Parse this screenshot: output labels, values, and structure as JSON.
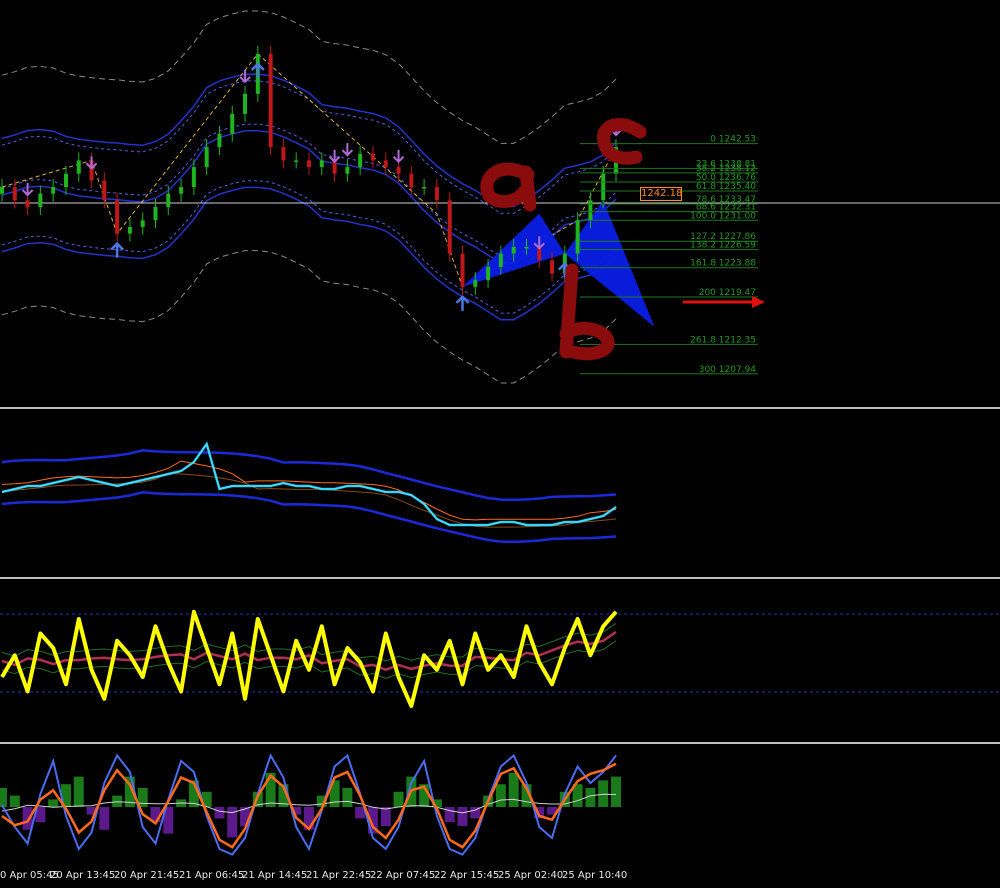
{
  "time_axis": [
    "0 Apr 05:45",
    "20 Apr 13:45",
    "20 Apr 21:45",
    "21 Apr 06:45",
    "21 Apr 14:45",
    "21 Apr 22:45",
    "22 Apr 07:45",
    "22 Apr 15:45",
    "25 Apr 02:40",
    "25 Apr 10:40"
  ],
  "current_price": "1242.18",
  "annotations": {
    "letter_a": "a",
    "letter_b": "b",
    "letter_c": "c"
  },
  "colors": {
    "background": "#000000",
    "bull_candle": "#1fb51f",
    "bear_candle": "#c01818",
    "fib_lines": "#1f7a1f",
    "fractal_up": "#4a78e0",
    "fractal_down": "#b06ad8",
    "pattern_fill": "#0a1ee6",
    "handwriting": "#8a0c0c",
    "rsi_line": "#ffff00",
    "stoch_k": "#ff6a1a",
    "stoch_d": "#4a6cf0",
    "hist_pos": "#1a7a1a",
    "hist_neg": "#5a1a8a"
  },
  "chart_data": [
    {
      "type": "line",
      "pane": "price",
      "fib_levels": [
        {
          "ratio": "0",
          "price": "1242.53"
        },
        {
          "ratio": "23.6",
          "price": "1238.81"
        },
        {
          "ratio": "38.2",
          "price": "1238.12"
        },
        {
          "ratio": "50.0",
          "price": "1236.76"
        },
        {
          "ratio": "61.8",
          "price": "1235.40"
        },
        {
          "ratio": "78.6",
          "price": "1233.47"
        },
        {
          "ratio": "88.6",
          "price": "1232.31"
        },
        {
          "ratio": "100.0",
          "price": "1231.00"
        },
        {
          "ratio": "127.2",
          "price": "1227.86"
        },
        {
          "ratio": "138.2",
          "price": "1226.59"
        },
        {
          "ratio": "161.8",
          "price": "1223.88"
        },
        {
          "ratio": "200",
          "price": "1219.47"
        },
        {
          "ratio": "261.8",
          "price": "1212.35"
        },
        {
          "ratio": "300",
          "price": "1207.94"
        }
      ],
      "close_series": [
        1236,
        1234,
        1233,
        1235,
        1236,
        1238,
        1240,
        1237,
        1234,
        1229,
        1230,
        1231,
        1233,
        1235,
        1236,
        1239,
        1242,
        1244,
        1247,
        1250,
        1256,
        1242,
        1240,
        1240,
        1239,
        1240,
        1238,
        1239,
        1241,
        1240,
        1239,
        1238,
        1236,
        1236,
        1234,
        1226,
        1221,
        1222,
        1224,
        1226,
        1227,
        1227,
        1225,
        1223,
        1226,
        1231,
        1234,
        1238,
        1242
      ]
    },
    {
      "type": "line",
      "pane": "indicator-1",
      "main_series": [
        46,
        47,
        48,
        48,
        49,
        50,
        51,
        50,
        49,
        48,
        49,
        50,
        51,
        52,
        53,
        56,
        62,
        47,
        48,
        48,
        48,
        48,
        49,
        48,
        48,
        47,
        47,
        48,
        48,
        47,
        46,
        46,
        45,
        42,
        37,
        35,
        35,
        35,
        35,
        36,
        36,
        35,
        35,
        35,
        36,
        36,
        37,
        38,
        41
      ]
    },
    {
      "type": "line",
      "pane": "indicator-2",
      "rsi_series": [
        40,
        55,
        30,
        70,
        60,
        35,
        80,
        45,
        25,
        65,
        55,
        40,
        75,
        50,
        30,
        85,
        60,
        35,
        70,
        25,
        80,
        55,
        30,
        65,
        45,
        75,
        35,
        60,
        50,
        30,
        70,
        40,
        20,
        55,
        45,
        65,
        35,
        70,
        45,
        55,
        40,
        75,
        50,
        35,
        60,
        80,
        55,
        75,
        85
      ]
    },
    {
      "type": "line",
      "pane": "indicator-3",
      "stoch_k": [
        50,
        30,
        15,
        60,
        90,
        40,
        10,
        25,
        70,
        95,
        80,
        30,
        15,
        55,
        90,
        80,
        40,
        10,
        5,
        20,
        60,
        95,
        75,
        30,
        10,
        45,
        85,
        95,
        60,
        20,
        10,
        30,
        70,
        90,
        40,
        10,
        5,
        20,
        55,
        85,
        95,
        70,
        30,
        20,
        60,
        85,
        70,
        80,
        95
      ],
      "histogram": [
        0.5,
        0.3,
        -0.6,
        -0.4,
        0.2,
        0.6,
        0.8,
        -0.2,
        -0.6,
        0.3,
        0.8,
        0.5,
        -0.4,
        -0.7,
        0.2,
        0.7,
        0.4,
        -0.3,
        -0.8,
        -0.5,
        0.4,
        0.9,
        0.6,
        -0.2,
        -0.6,
        0.3,
        0.7,
        0.5,
        -0.3,
        -0.7,
        -0.5,
        0.4,
        0.8,
        0.6,
        0.2,
        -0.4,
        -0.5,
        -0.3,
        0.3,
        0.6,
        0.9,
        0.6,
        -0.3,
        -0.2,
        0.4,
        0.6,
        0.5,
        0.7,
        0.8
      ]
    }
  ]
}
